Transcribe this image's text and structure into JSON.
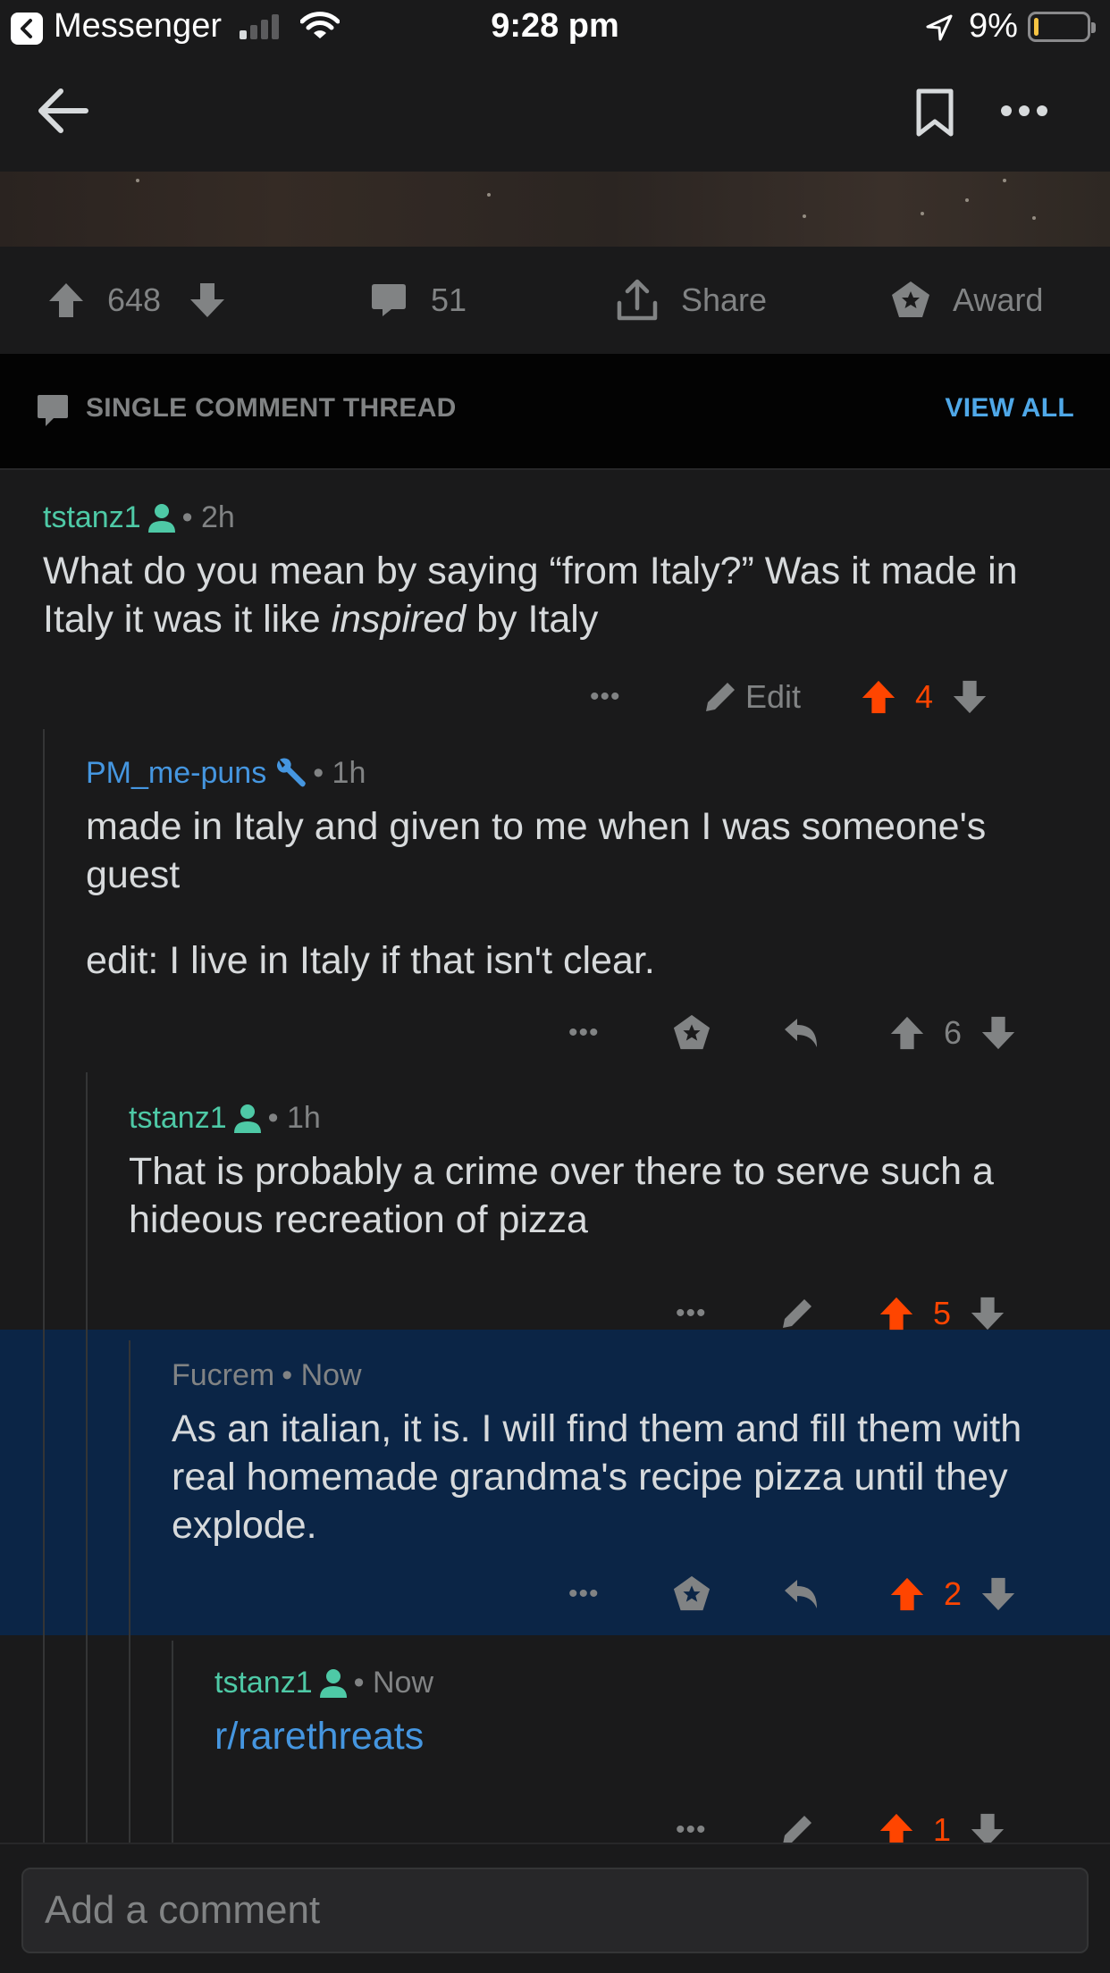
{
  "status_bar": {
    "back_app": "Messenger",
    "time": "9:28 pm",
    "battery": "9%",
    "battery_level": 0.09
  },
  "nav": {
    "back_icon": "arrow-left-icon",
    "bookmark_icon": "bookmark-icon",
    "more_icon": "more-horizontal-icon"
  },
  "post_actions": {
    "score": "648",
    "comments": "51",
    "share": "Share",
    "award": "Award"
  },
  "thread": {
    "label": "SINGLE COMMENT THREAD",
    "view_all": "VIEW ALL"
  },
  "comments": [
    {
      "user": "tstanz1",
      "time": "• 2h",
      "body_before": "What do you mean by saying “from Italy?” Was it made in Italy it was it like ",
      "body_em": "inspired",
      "body_after": " by Italy",
      "edit": "Edit",
      "score": "4"
    },
    {
      "user": "PM_me-puns",
      "time": "• 1h",
      "body": "made in Italy and given to me when I was someone's guest",
      "body2": "edit: I live in Italy if that isn't clear.",
      "score": "6"
    },
    {
      "user": "tstanz1",
      "time": "• 1h",
      "body": "That is probably a crime over there to serve such a hideous recreation of pizza",
      "score": "5"
    },
    {
      "user": "Fucrem",
      "time": "• Now",
      "body": "As an italian, it is. I will find them and fill them with real homemade grandma's recipe pizza until they explode.",
      "score": "2"
    },
    {
      "user": "tstanz1",
      "time": "• Now",
      "body": "r/rarethreats",
      "score": "1"
    }
  ],
  "compose": {
    "placeholder": "Add a comment"
  },
  "colors": {
    "background": "#1a1a1b",
    "upvote": "#ff4500",
    "user_op": "#4ec9a6",
    "user_mod": "#4596e0",
    "highlight": "#0b2546",
    "link": "#4596e0"
  }
}
